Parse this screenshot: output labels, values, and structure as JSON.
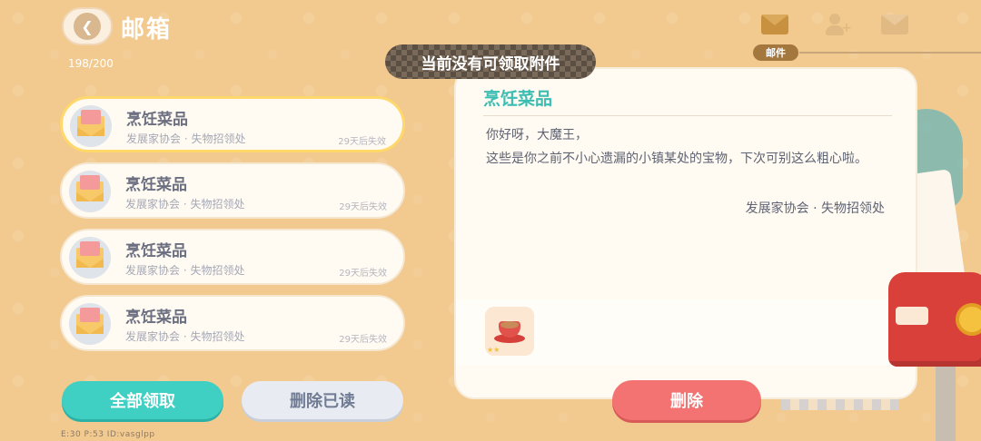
{
  "header": {
    "title": "邮箱",
    "mail_count": "198/200",
    "back_icon": "chevron-left-icon"
  },
  "toast": {
    "message": "当前没有可领取附件"
  },
  "tabs": {
    "active_label": "邮件",
    "icons": [
      "mail-icon",
      "add-friend-icon",
      "star-mail-icon"
    ]
  },
  "mail_list": [
    {
      "title": "烹饪菜品",
      "sender": "发展家协会 · 失物招领处",
      "expire": "29天后失效"
    },
    {
      "title": "烹饪菜品",
      "sender": "发展家协会 · 失物招领处",
      "expire": "29天后失效"
    },
    {
      "title": "烹饪菜品",
      "sender": "发展家协会 · 失物招领处",
      "expire": "29天后失效"
    },
    {
      "title": "烹饪菜品",
      "sender": "发展家协会 · 失物招领处",
      "expire": "29天后失效"
    }
  ],
  "buttons": {
    "claim_all": "全部领取",
    "delete_read": "删除已读",
    "delete": "删除"
  },
  "detail": {
    "title": "烹饪菜品",
    "greeting": "你好呀，大魔王，",
    "body": "这些是你之前不小心遗漏的小镇某处的宝物，下次可别这么粗心啦。",
    "signature": "发展家协会 · 失物招领处",
    "attachment_icon": "coffee-cup-icon"
  },
  "footer": {
    "info": "E:30   P:53   ID:vasglpp"
  },
  "colors": {
    "background": "#f2c98e",
    "accent_teal": "#3fd0c3",
    "delete_red": "#f27371",
    "title_teal": "#3bbdb2"
  }
}
